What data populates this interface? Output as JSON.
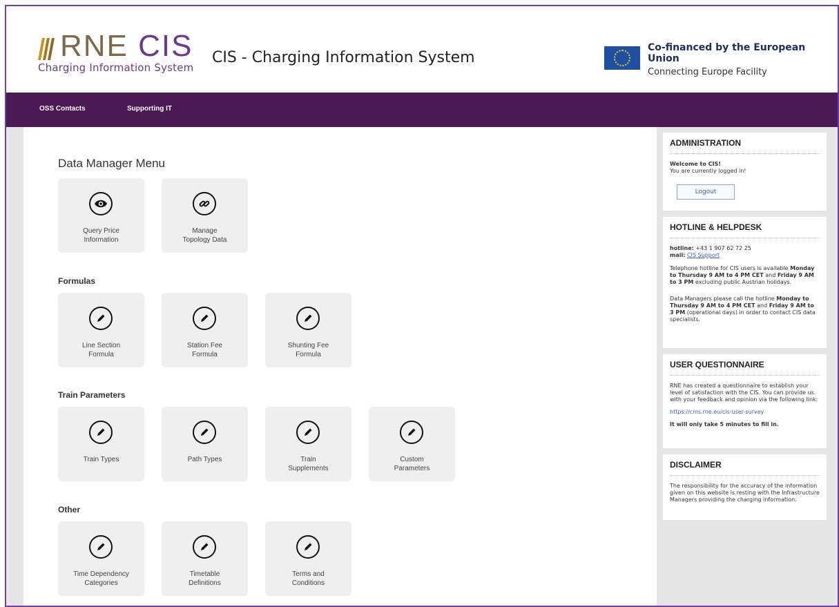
{
  "header": {
    "logo_rne": "RNE",
    "logo_cis": "CIS",
    "logo_subtitle": "Charging Information System",
    "site_title": "CIS - Charging Information System",
    "eu_line1": "Co-financed by the European Union",
    "eu_line2": "Connecting Europe Facility"
  },
  "nav": {
    "items": [
      {
        "label": "OSS Contacts"
      },
      {
        "label": "Supporting IT"
      }
    ]
  },
  "main": {
    "menu_title": "Data Manager Menu",
    "top_tiles": [
      {
        "icon": "eye-icon",
        "label1": "Query Price",
        "label2": "Information"
      },
      {
        "icon": "link-icon",
        "label1": "Manage",
        "label2": "Topology Data"
      }
    ],
    "sections": [
      {
        "title": "Formulas",
        "tiles": [
          {
            "label1": "Line Section",
            "label2": "Formula"
          },
          {
            "label1": "Station Fee",
            "label2": "Formula"
          },
          {
            "label1": "Shunting Fee",
            "label2": "Formula"
          }
        ]
      },
      {
        "title": "Train Parameters",
        "tiles": [
          {
            "label1": "Train Types",
            "label2": ""
          },
          {
            "label1": "Path Types",
            "label2": ""
          },
          {
            "label1": "Train",
            "label2": "Supplements"
          },
          {
            "label1": "Custom",
            "label2": "Parameters"
          }
        ]
      },
      {
        "title": "Other",
        "tiles": [
          {
            "label1": "Time Dependency",
            "label2": "Categories"
          },
          {
            "label1": "Timetable",
            "label2": "Definitions"
          },
          {
            "label1": "Terms and",
            "label2": "Conditions"
          }
        ]
      }
    ]
  },
  "sidebar": {
    "administration": {
      "title": "ADMINISTRATION",
      "welcome": "Welcome to CIS!",
      "status": "You are currently logged in!",
      "logout": "Logout"
    },
    "hotline": {
      "title": "HOTLINE & HELPDESK",
      "hotline_label": "hotline:",
      "hotline_value": "+43 1 907 62 72 25",
      "mail_label": "mail:",
      "mail_value": "CIS Support",
      "p1_a": "Telephone hotline for CIS users is available",
      "p1_b": "Monday to Thursday 9 AM to 4 PM CET",
      "p1_c": "and",
      "p1_d": "Friday 9 AM to 3 PM",
      "p1_e": "excluding public Austrian holidays.",
      "p2_a": "Data Managers please call the hotline",
      "p2_b": "Monday to Thursday 9 AM to 4 PM CET",
      "p2_c": "and",
      "p2_d": "Friday 9 AM to 3 PM",
      "p2_e": "(operational days) in order to contact CIS data specialists."
    },
    "questionnaire": {
      "title": "USER QUESTIONNAIRE",
      "text": "RNE has created a questionnaire to establish your level of satisfaction with the CIS. You can provide us with your feedback and opinion via the following link:",
      "link": "https://cms.rne.eu/cis-user-survey",
      "note": "It will only take 5 minutes to fill in."
    },
    "disclaimer": {
      "title": "DISCLAIMER",
      "text": "The responsibility for the accuracy of the information given on this website is resting with the Infrastructure Managers providing the charging information."
    }
  }
}
